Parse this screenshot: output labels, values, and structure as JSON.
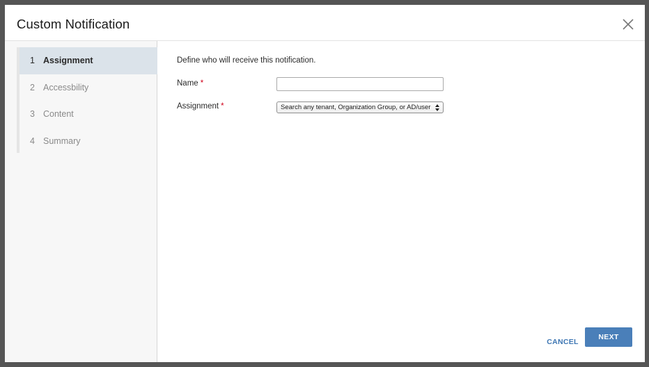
{
  "modal": {
    "title": "Custom Notification"
  },
  "steps": [
    {
      "num": "1",
      "label": "Assignment",
      "active": true
    },
    {
      "num": "2",
      "label": "Accessbility",
      "active": false
    },
    {
      "num": "3",
      "label": "Content",
      "active": false
    },
    {
      "num": "4",
      "label": "Summary",
      "active": false
    }
  ],
  "form": {
    "intro": "Define who will receive this notification.",
    "name_label": "Name",
    "name_value": "",
    "assignment_label": "Assignment",
    "required_marker": "*",
    "assignment_selected": "Search any tenant, Organization Group, or AD/user"
  },
  "footer": {
    "cancel_label": "CANCEL",
    "next_label": "NEXT"
  },
  "colors": {
    "accent": "#4a7fb9",
    "link": "#3d76b3",
    "required": "#d0021b",
    "active_step_bg": "#dbe3ea"
  },
  "icons": {
    "close": "close-icon",
    "select_arrows": "chevron-updown-icon"
  }
}
